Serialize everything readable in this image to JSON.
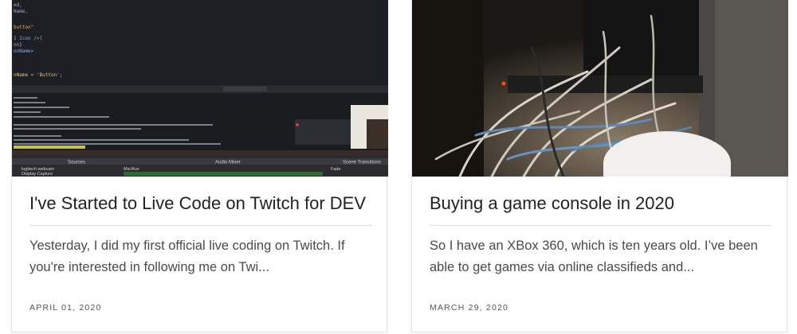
{
  "posts": [
    {
      "title": "I've Started to Live Code on Twitch for DEV",
      "excerpt": "Yesterday, I did my first official live coding on Twitch. If you're interested in following me on Twi...",
      "date": "APRIL 01, 2020",
      "thumbnail": {
        "kind": "obs-screenshot",
        "code_lines": [
          "ed,",
          "Name,",
          "button\"",
          "1 Icon />]",
          "on}",
          "onName>",
          "nName = 'Button';"
        ],
        "panels": [
          "Sources",
          "Audio Mixer",
          "Scene Transitions"
        ],
        "sources": [
          "logitech webcam",
          "Display Capture"
        ],
        "mixer_channel": "Mic/Aux",
        "transition": "Fade"
      }
    },
    {
      "title": "Buying a game console in 2020",
      "excerpt": "So I have an XBox 360, which is ten years old. I’ve been able to get games via online classifieds and...",
      "date": "MARCH 29, 2020",
      "thumbnail": {
        "kind": "photo-cables"
      }
    }
  ]
}
